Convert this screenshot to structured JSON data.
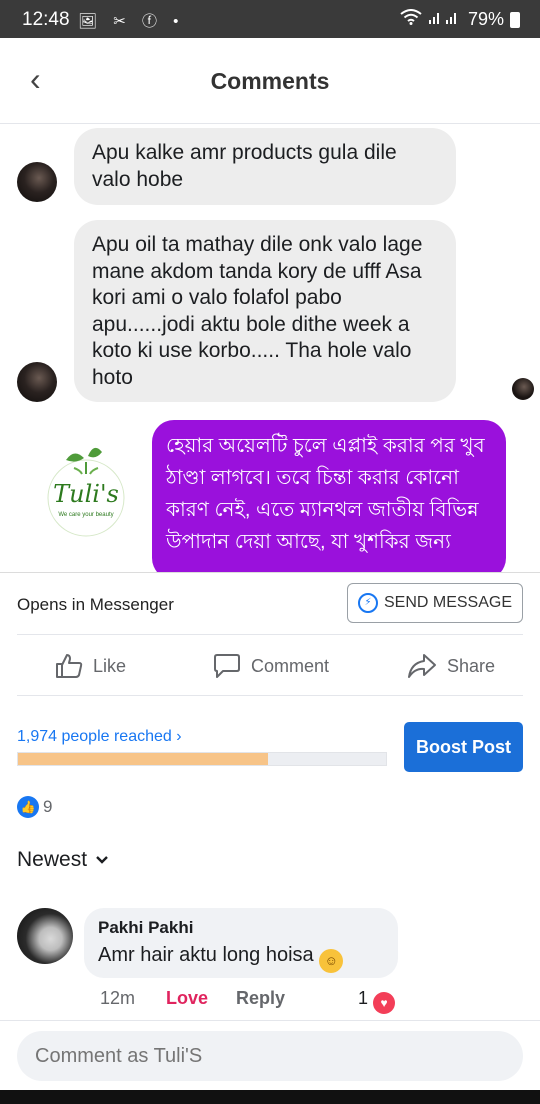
{
  "status_bar": {
    "time": "12:48",
    "left_icons": "🖼 ✂ ⓕ •",
    "battery": "79%"
  },
  "header": {
    "title": "Comments",
    "back_icon": "‹"
  },
  "chat": {
    "messages": [
      {
        "from": "customer",
        "text": "Apu kalke amr products gula dile valo hobe"
      },
      {
        "from": "customer",
        "text": "Apu oil ta mathay dile onk valo lage mane akdom tanda kory de ufff Asa kori ami o valo folafol pabo apu......jodi aktu bole dithe week a koto ki use korbo..... Tha hole valo hoto"
      },
      {
        "from": "page",
        "text": "হেয়ার অয়েলটি চুলে এপ্লাই করার পর খুব ঠাণ্ডা লাগবে। তবে চিন্তা করার কোনো কারণ নেই, এতে ম্যানথল জাতীয় বিভিন্ন উপাদান দেয়া আছে, যা খুশকির জন্য"
      }
    ],
    "logo": {
      "name": "Tuli's",
      "tagline": "We care your beauty"
    }
  },
  "messenger_bar": {
    "opens_text": "Opens in Messenger",
    "send_label": "SEND MESSAGE"
  },
  "actions": {
    "like": "Like",
    "comment": "Comment",
    "share": "Share"
  },
  "insights": {
    "reached": "1,974 people reached",
    "reached_fraction": 0.68,
    "boost_label": "Boost Post"
  },
  "reactions": {
    "count": "9"
  },
  "sort": {
    "label": "Newest"
  },
  "comment": {
    "author": "Pakhi Pakhi",
    "text": "Amr hair aktu long hoisa",
    "emoji": "😊",
    "time": "12m",
    "love_label": "Love",
    "reply_label": "Reply",
    "reaction_count": "1"
  },
  "composer": {
    "placeholder": "Comment as Tuli'S"
  },
  "colors": {
    "brand_blue": "#1877f2",
    "boost_blue": "#1b6fd8",
    "page_bubble": "#9a11dc",
    "progress_fill": "#f7c488",
    "love_red": "#e0245e"
  }
}
